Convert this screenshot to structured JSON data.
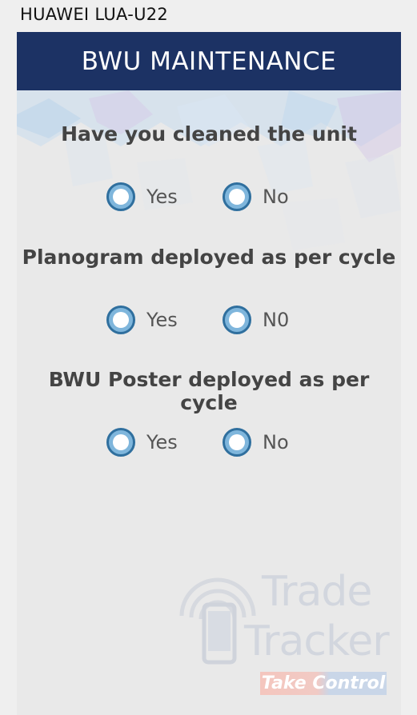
{
  "device": {
    "label": "HUAWEI LUA-U22"
  },
  "header": {
    "title": "BWU MAINTENANCE"
  },
  "questions": [
    {
      "text": "Have you cleaned the unit",
      "options": [
        "Yes",
        "No"
      ]
    },
    {
      "text": "Planogram deployed as per cycle",
      "options": [
        "Yes",
        "N0"
      ]
    },
    {
      "text": "BWU Poster deployed as per cycle",
      "options": [
        "Yes",
        "No"
      ]
    }
  ],
  "watermark": {
    "line1": "Trade",
    "line2": "Tracker",
    "tagline": "Take Control"
  },
  "colors": {
    "appbar": "#1c3264",
    "radio_fill": "#7fb6dc",
    "radio_border": "#2f6f9e",
    "question_text": "#444444"
  }
}
